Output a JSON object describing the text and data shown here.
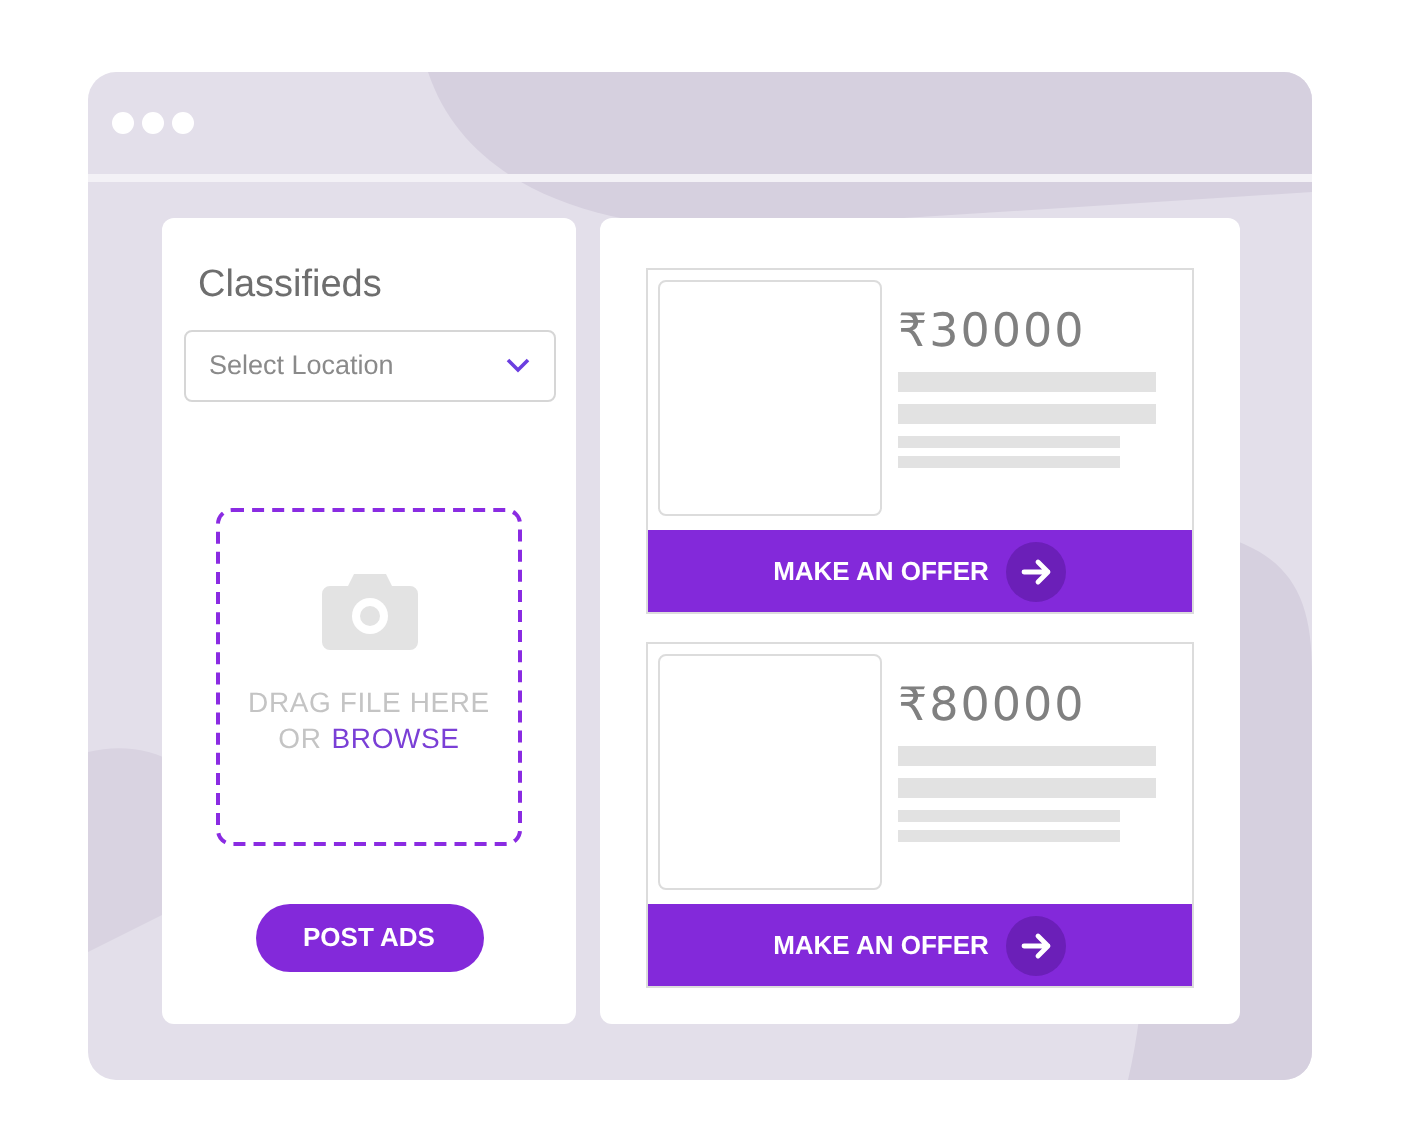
{
  "sidebar": {
    "title": "Classifieds",
    "location_select": {
      "placeholder": "Select Location"
    },
    "upload": {
      "line1": "DRAG FILE HERE",
      "prefix": "OR",
      "link": "BROWSE"
    },
    "post_button": "POST ADS"
  },
  "listings": [
    {
      "price": "₹30000",
      "button": "MAKE AN OFFER"
    },
    {
      "price": "₹80000",
      "button": "MAKE AN OFFER"
    }
  ]
}
